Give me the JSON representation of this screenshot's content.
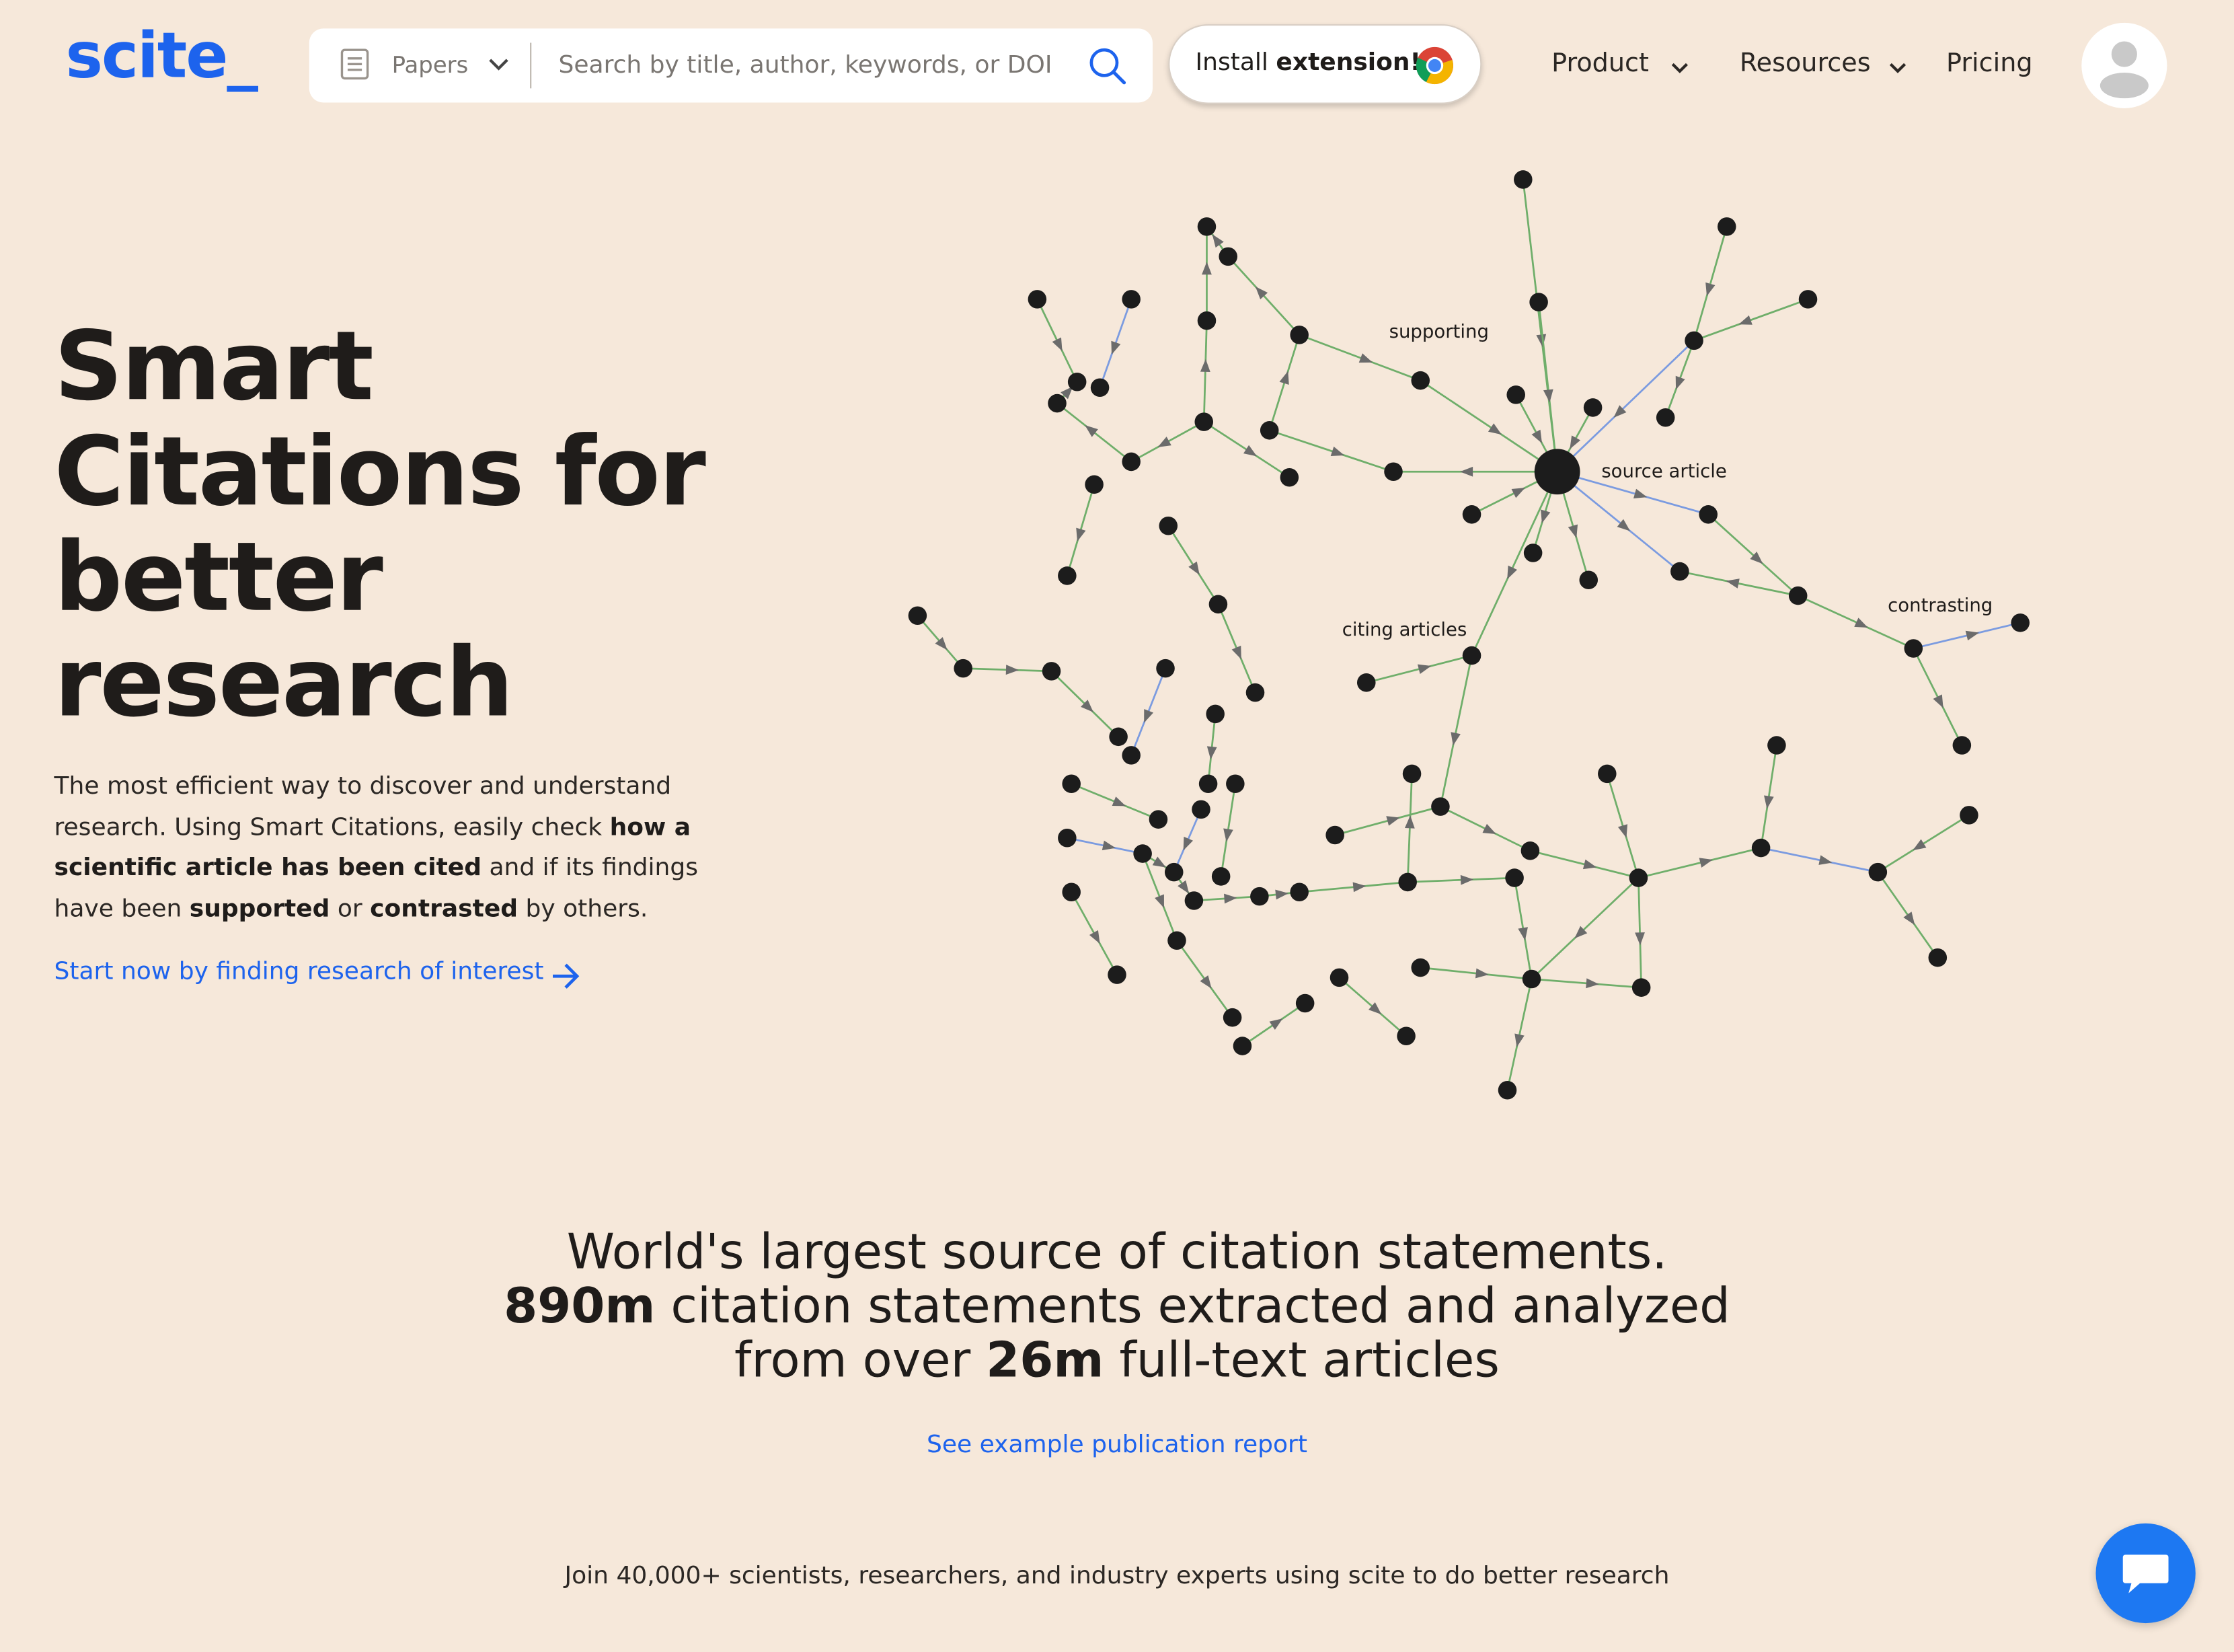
{
  "brand": {
    "logo": "scite_",
    "accent": "#1d63ed"
  },
  "header": {
    "search": {
      "scope": "Papers",
      "placeholder": "Search by title, author, keywords, or DOI",
      "icon": "search-icon"
    },
    "install": {
      "prefix": "Install",
      "emphasis": "extension!",
      "icon": "chrome-icon"
    },
    "nav": [
      {
        "label": "Product",
        "has_dropdown": true
      },
      {
        "label": "Resources",
        "has_dropdown": true
      },
      {
        "label": "Pricing",
        "has_dropdown": false
      }
    ]
  },
  "hero": {
    "title_lines": [
      "Smart",
      "Citations for",
      "better",
      "research"
    ],
    "desc": {
      "p1": "The most efficient way to discover and understand research. Using Smart Citations, easily check ",
      "b1": "how a scientific article has been cited",
      "p2": " and if its findings have been ",
      "b2": "supported",
      "p3": " or ",
      "b3": "contrasted",
      "p4": " by others."
    },
    "cta": "Start now by finding research of interest"
  },
  "graph": {
    "labels": {
      "supporting": "supporting",
      "source": "source article",
      "citing": "citing articles",
      "contrasting": "contrasting"
    },
    "colors": {
      "supporting": "#6fae6a",
      "contrasting": "#7b9be0",
      "node": "#1c1c1c",
      "arrow": "#6b6b6b"
    }
  },
  "stats": {
    "line1": "World's largest source of citation statements.",
    "line2_num": "890m",
    "line2_rest": " citation statements extracted and analyzed",
    "line3_pre": "from over ",
    "line3_num": "26m",
    "line3_rest": " full-text articles"
  },
  "links": {
    "report": "See example publication report"
  },
  "join": "Join 40,000+ scientists, researchers, and industry experts using scite to do better research",
  "chat": {
    "icon": "chat-icon"
  }
}
